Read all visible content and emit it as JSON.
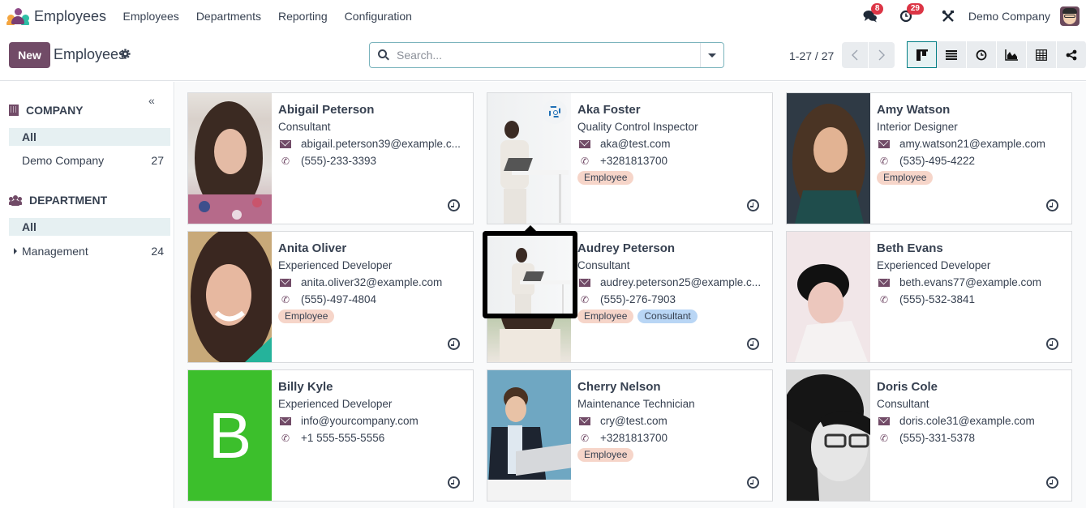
{
  "app": {
    "name": "Employees",
    "menu": [
      "Employees",
      "Departments",
      "Reporting",
      "Configuration"
    ],
    "messages_count": "8",
    "activities_count": "29",
    "company": "Demo Company"
  },
  "control_panel": {
    "new_label": "New",
    "title": "Employees",
    "search_placeholder": "Search...",
    "pager": "1-27 / 27",
    "views": [
      "kanban",
      "list",
      "activity",
      "graph",
      "pivot",
      "hierarchy"
    ],
    "active_view": "kanban"
  },
  "sidebar": {
    "company": {
      "title": "COMPANY",
      "items": [
        {
          "label": "All",
          "count": "",
          "active": true
        },
        {
          "label": "Demo Company",
          "count": "27",
          "active": false
        }
      ]
    },
    "department": {
      "title": "DEPARTMENT",
      "items": [
        {
          "label": "All",
          "count": "",
          "active": true
        },
        {
          "label": "Management",
          "count": "24",
          "active": false,
          "expandable": true
        }
      ]
    }
  },
  "employees": [
    {
      "name": "Abigail Peterson",
      "job": "Consultant",
      "email": "abigail.peterson39@example.c...",
      "phone": "(555)-233-3393",
      "tags": []
    },
    {
      "name": "Aka Foster",
      "job": "Quality Control Inspector",
      "email": "aka@test.com",
      "phone": "+3281813700",
      "tags": [
        "Employee"
      ]
    },
    {
      "name": "Amy Watson",
      "job": "Interior Designer",
      "email": "amy.watson21@example.com",
      "phone": "(535)-495-4222",
      "tags": [
        "Employee"
      ]
    },
    {
      "name": "Anita Oliver",
      "job": "Experienced Developer",
      "email": "anita.oliver32@example.com",
      "phone": "(555)-497-4804",
      "tags": [
        "Employee"
      ]
    },
    {
      "name": "Audrey Peterson",
      "job": "Consultant",
      "email": "audrey.peterson25@example.c...",
      "phone": "(555)-276-7903",
      "tags": [
        "Employee",
        "Consultant"
      ]
    },
    {
      "name": "Beth Evans",
      "job": "Experienced Developer",
      "email": "beth.evans77@example.com",
      "phone": "(555)-532-3841",
      "tags": []
    },
    {
      "name": "Billy Kyle",
      "job": "Experienced Developer",
      "email": "info@yourcompany.com",
      "phone": "+1 555-555-5556",
      "tags": [],
      "avatar_letter": "B",
      "avatar_color": "#3cbf2c"
    },
    {
      "name": "Cherry Nelson",
      "job": "Maintenance Technician",
      "email": "cry@test.com",
      "phone": "+3281813700",
      "tags": [
        "Employee"
      ]
    },
    {
      "name": "Doris Cole",
      "job": "Consultant",
      "email": "doris.cole31@example.com",
      "phone": "(555)-331-5378",
      "tags": []
    }
  ],
  "colors": {
    "brand": "#714b67",
    "accent": "#017e84",
    "badge": "#dc3545",
    "tag_employee": "#f6d5c9",
    "tag_consultant": "#b9d6f5"
  }
}
